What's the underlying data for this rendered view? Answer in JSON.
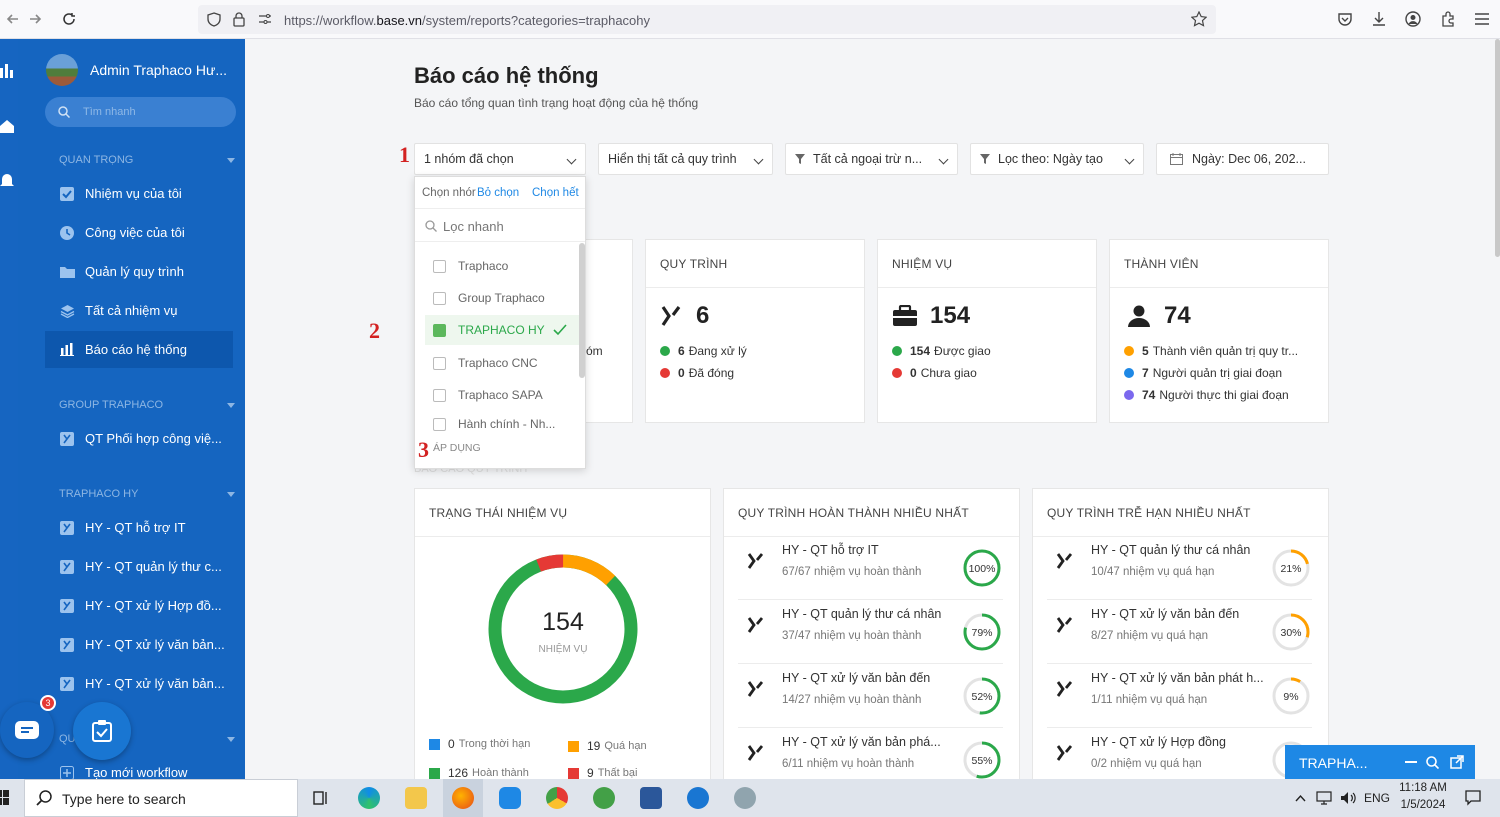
{
  "browser": {
    "url_prefix": "https://workflow.",
    "url_domain": "base.vn",
    "url_path": "/system/reports?categories=traphacohy"
  },
  "sidebar": {
    "user_name": "Admin Traphaco Hư...",
    "search_placeholder": "Tìm nhanh",
    "sections": [
      {
        "title": "QUAN TRỌNG"
      },
      {
        "title": "GROUP TRAPHACO"
      },
      {
        "title": "TRAPHACO HY"
      },
      {
        "title": "QU"
      }
    ],
    "items": [
      {
        "label": "Nhiệm vụ của tôi"
      },
      {
        "label": "Công việc của tôi"
      },
      {
        "label": "Quản lý quy trình"
      },
      {
        "label": "Tất cả nhiệm vụ"
      },
      {
        "label": "Báo cáo hệ thống"
      },
      {
        "label": "QT Phối hợp công việ..."
      },
      {
        "label": "HY - QT hỗ trợ IT"
      },
      {
        "label": "HY - QT quản lý thư c..."
      },
      {
        "label": "HY - QT xử lý Hợp đồ..."
      },
      {
        "label": "HY - QT xử lý văn bản..."
      },
      {
        "label": "HY - QT xử lý văn bản..."
      },
      {
        "label": "Tạo mới workflow"
      }
    ]
  },
  "page": {
    "title": "Báo cáo hệ thống",
    "subtitle": "Báo cáo tổng quan tình trạng hoạt động của hệ thống"
  },
  "filters": {
    "groups": "1 nhóm đã chọn",
    "processes": "Hiển thị tất cả quy trình",
    "exclude": "Tất cả ngoại trừ n...",
    "sort": "Lọc theo: Ngày tạo",
    "date": "Ngày: Dec 06, 202..."
  },
  "dropdown": {
    "label": "Chọn nhór",
    "deselect": "Bỏ chọn",
    "select_all": "Chọn hết",
    "search_placeholder": "Lọc nhanh",
    "options": [
      {
        "label": "Traphaco",
        "checked": false
      },
      {
        "label": "Group Traphaco",
        "checked": false
      },
      {
        "label": "TRAPHACO HY",
        "checked": true
      },
      {
        "label": "Traphaco CNC",
        "checked": false
      },
      {
        "label": "Traphaco SAPA",
        "checked": false
      },
      {
        "label": "Hành chính - Nh...",
        "checked": false
      }
    ],
    "apply": "ÁP DỤNG"
  },
  "annotations": [
    "1",
    "2",
    "3"
  ],
  "partial_card_text": "óm",
  "section_label_partial": "BÁO CÁO QUY TRÌNH",
  "cards": {
    "process": {
      "title": "QUY TRÌNH",
      "count": "6",
      "s1_num": "6",
      "s1_label": "Đang xử lý",
      "s2_num": "0",
      "s2_label": "Đã đóng"
    },
    "task": {
      "title": "NHIỆM VỤ",
      "count": "154",
      "s1_num": "154",
      "s1_label": "Được giao",
      "s2_num": "0",
      "s2_label": "Chưa giao"
    },
    "member": {
      "title": "THÀNH VIÊN",
      "count": "74",
      "s1_num": "5",
      "s1_label": "Thành viên quản trị quy tr...",
      "s2_num": "7",
      "s2_label": "Người quản trị giai đoạn",
      "s3_num": "74",
      "s3_label": "Người thực thi giai đoạn"
    }
  },
  "task_status": {
    "title": "TRẠNG THÁI NHIỆM VỤ",
    "total": "154",
    "total_label": "NHIỆM VỤ",
    "legend": [
      {
        "num": "0",
        "label": "Trong thời hạn",
        "color": "#1e88e5"
      },
      {
        "num": "19",
        "label": "Quá hạn",
        "color": "#ffa000"
      },
      {
        "num": "126",
        "label": "Hoàn thành",
        "color": "#2ba84a"
      },
      {
        "num": "9",
        "label": "Thất bại",
        "color": "#e53935"
      }
    ]
  },
  "top_completed": {
    "title": "QUY TRÌNH HOÀN THÀNH NHIỀU NHẤT",
    "rows": [
      {
        "name": "HY - QT hỗ trợ IT",
        "detail": "67/67 nhiệm vụ hoàn thành",
        "pct": "100%",
        "value": 100
      },
      {
        "name": "HY - QT quản lý thư cá nhân",
        "detail": "37/47 nhiệm vụ hoàn thành",
        "pct": "79%",
        "value": 79
      },
      {
        "name": "HY - QT xử lý văn bản đến",
        "detail": "14/27 nhiệm vụ hoàn thành",
        "pct": "52%",
        "value": 52
      },
      {
        "name": "HY - QT xử lý văn bản phá...",
        "detail": "6/11 nhiệm vụ hoàn thành",
        "pct": "55%",
        "value": 55
      }
    ]
  },
  "top_late": {
    "title": "QUY TRÌNH TRỄ HẠN NHIỀU NHẤT",
    "rows": [
      {
        "name": "HY - QT quản lý thư cá nhân",
        "detail": "10/47 nhiệm vụ quá hạn",
        "pct": "21%",
        "value": 21
      },
      {
        "name": "HY - QT xử lý văn bản đến",
        "detail": "8/27 nhiệm vụ quá hạn",
        "pct": "30%",
        "value": 30
      },
      {
        "name": "HY - QT xử lý văn bản phát h...",
        "detail": "1/11 nhiệm vụ quá hạn",
        "pct": "9%",
        "value": 9
      },
      {
        "name": "HY - QT xử lý Hợp đồng",
        "detail": "0/2 nhiệm vụ quá hạn",
        "pct": "",
        "value": 0
      }
    ]
  },
  "chat": {
    "badge": "3",
    "widget_title": "TRAPHA..."
  },
  "taskbar": {
    "search": "Type here to search",
    "lang": "ENG",
    "time": "11:18 AM",
    "date": "1/5/2024"
  },
  "colors": {
    "sidebar": "#1565c0",
    "green": "#2ba84a",
    "orange": "#ffa000",
    "red": "#e53935",
    "blue": "#1e88e5",
    "purple": "#7b68ee"
  }
}
